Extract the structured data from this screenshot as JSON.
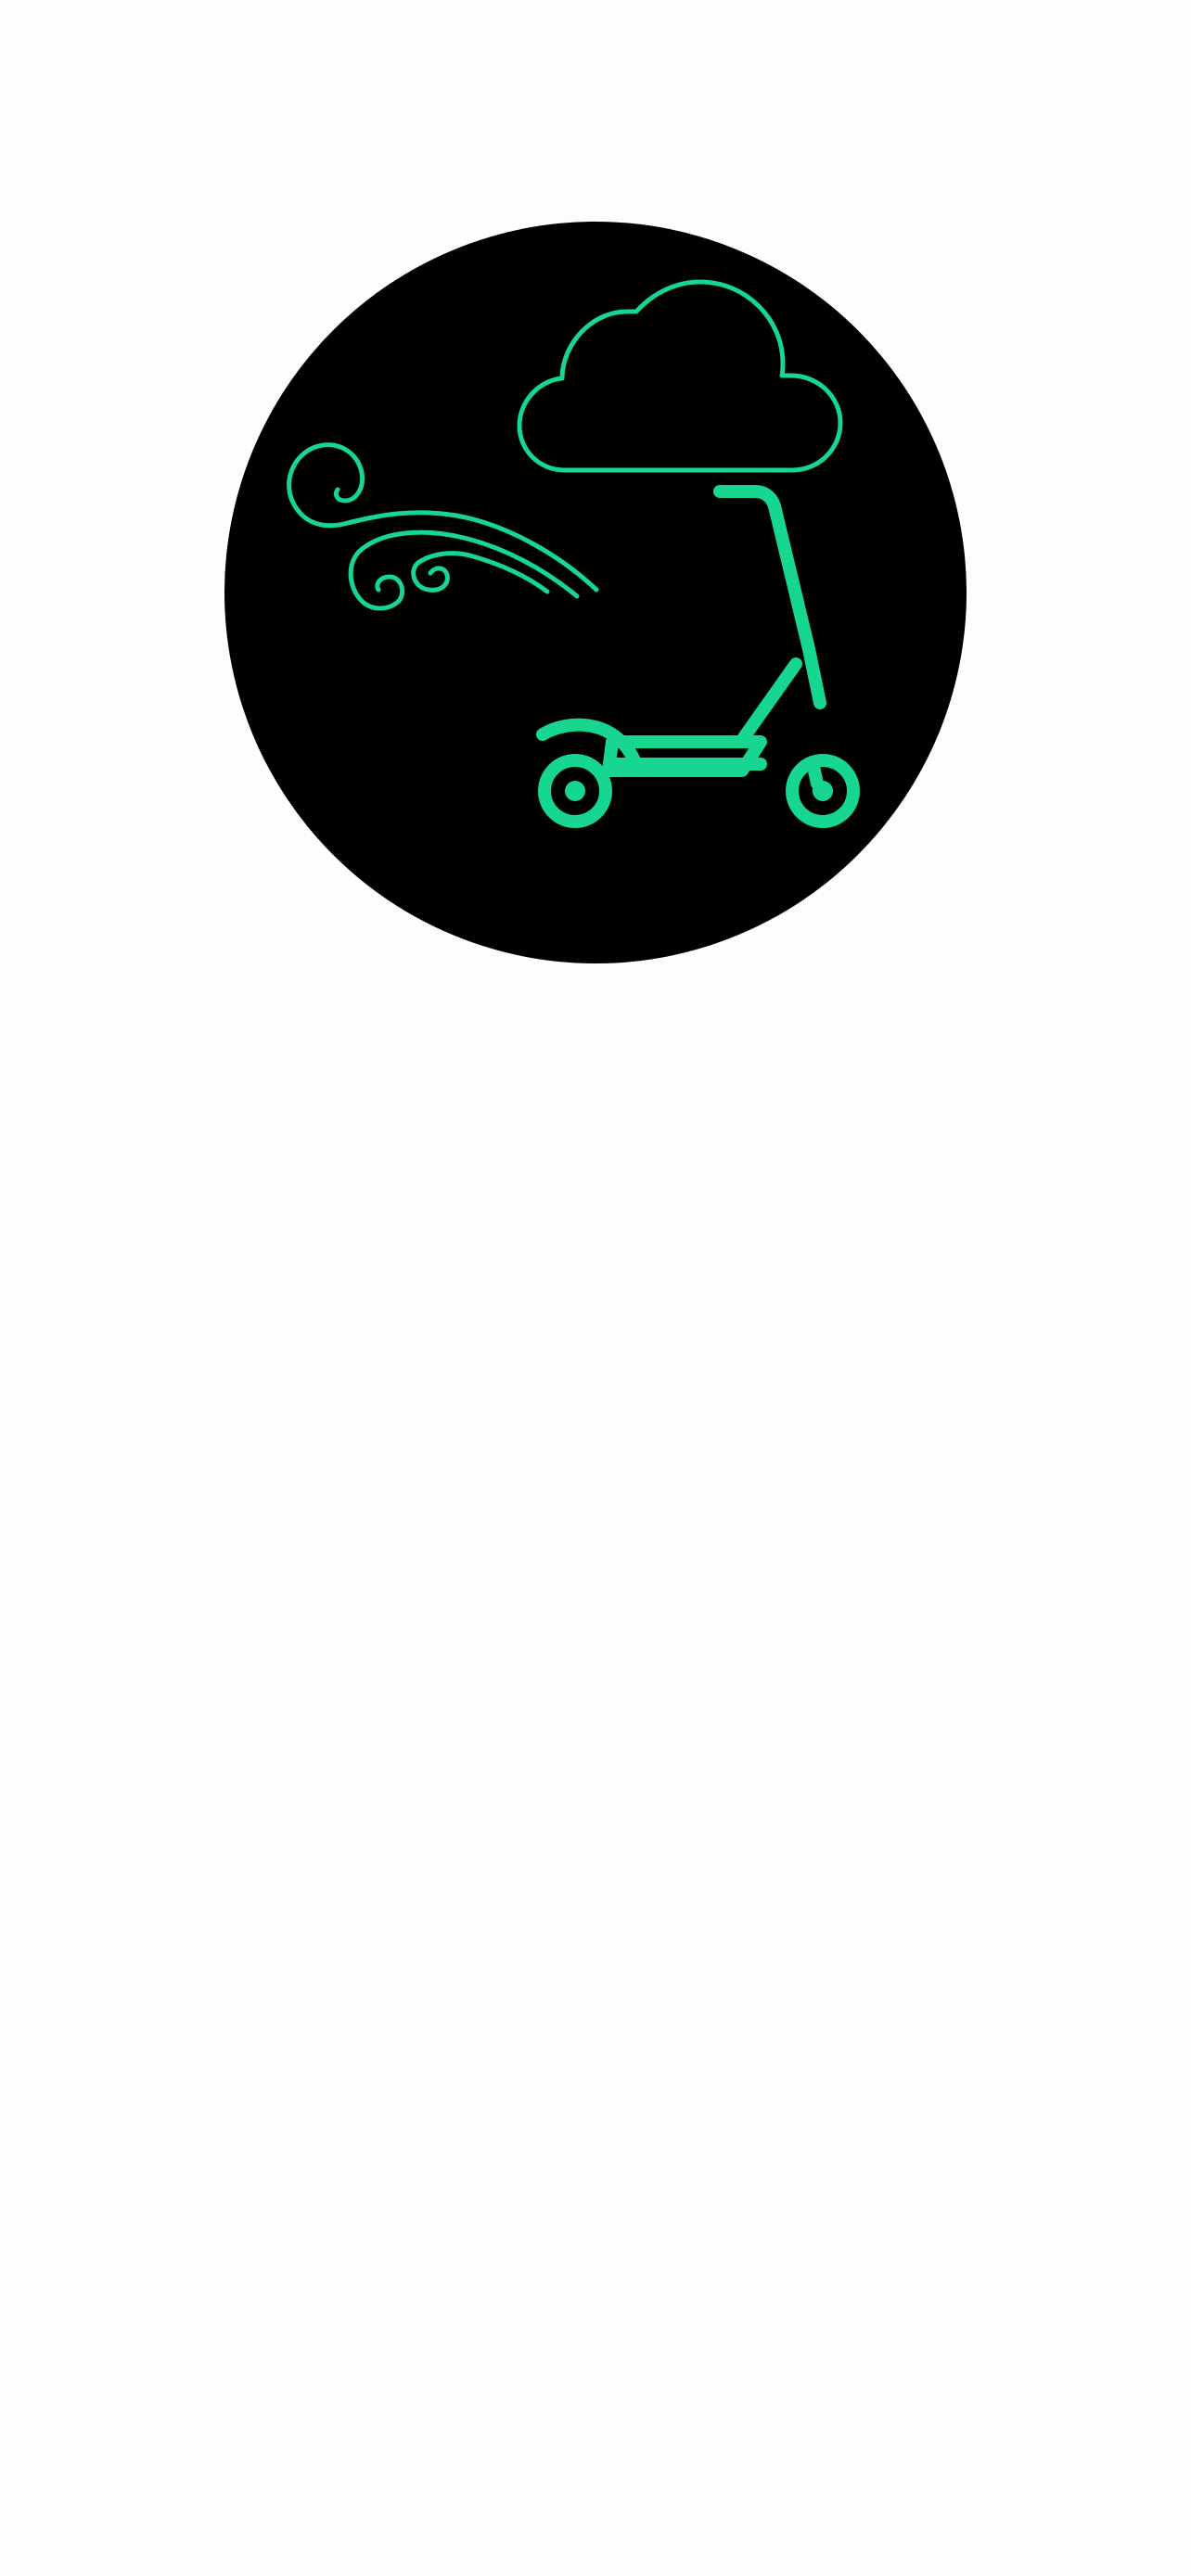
{
  "page": {
    "background_color": "#fdfdfd"
  },
  "illustration": {
    "circle_color": "#000000",
    "accent_color": "#17d68f",
    "icons": [
      "cloud-icon",
      "wind-icon",
      "electric-scooter-icon"
    ]
  }
}
